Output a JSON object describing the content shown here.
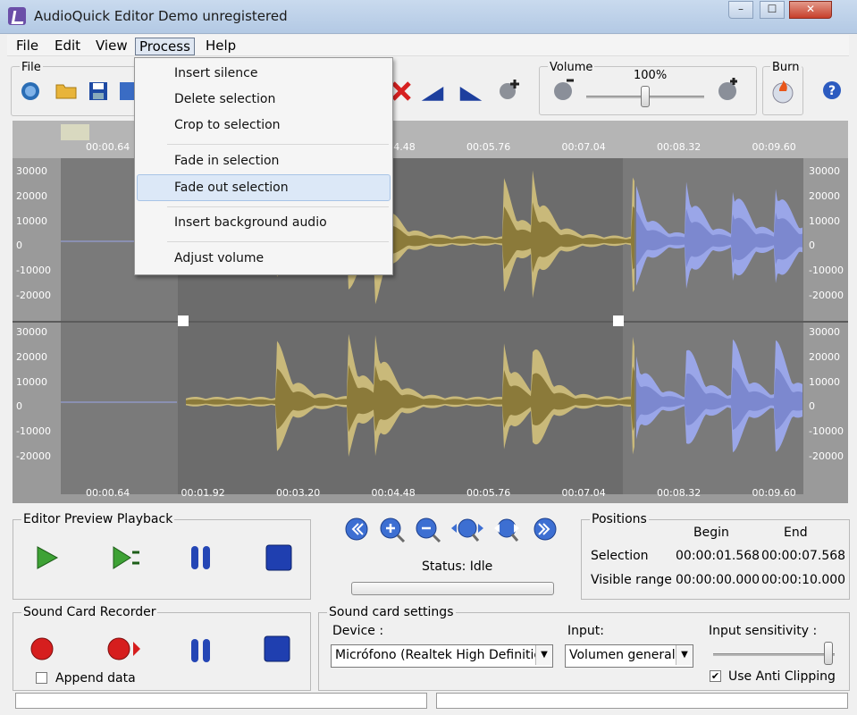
{
  "window": {
    "title": "AudioQuick Editor Demo unregistered",
    "min_glyph": "–",
    "max_glyph": "☐",
    "close_glyph": "✕"
  },
  "menubar": {
    "items": [
      "File",
      "Edit",
      "View",
      "Process",
      "Help"
    ]
  },
  "process_menu": {
    "group1": [
      "Insert silence",
      "Delete selection",
      "Crop to selection"
    ],
    "group2": [
      "Fade in selection",
      "Fade out selection"
    ],
    "group3": [
      "Insert background audio"
    ],
    "group4": [
      "Adjust volume"
    ],
    "highlighted": "Fade out selection"
  },
  "toolbar": {
    "file_label": "File",
    "volume_label": "Volume",
    "volume_value": "100%",
    "volume_level": 0.5,
    "burn_label": "Burn"
  },
  "waveform": {
    "amplitude_labels": [
      "30000",
      "20000",
      "10000",
      "0",
      "-10000",
      "-20000"
    ],
    "time_labels": [
      "00:00.64",
      "00:01.92",
      "00:03.20",
      "00:04.48",
      "00:05.76",
      "00:07.04",
      "00:08.32",
      "00:09.60"
    ],
    "colors": {
      "wave": "#8b7a3a",
      "wave_light": "#c9b97a",
      "wave_highlight": "#9aa6e8",
      "background": "#7a7a7a",
      "selection": "#6b6b6b"
    }
  },
  "preview": {
    "label": "Editor Preview Playback"
  },
  "nav": {
    "status": "Status: Idle"
  },
  "positions": {
    "label": "Positions",
    "begin": "Begin",
    "end": "End",
    "selection_label": "Selection",
    "selection_begin": "00:00:01.568",
    "selection_end": "00:00:07.568",
    "visible_label": "Visible range",
    "visible_begin": "00:00:00.000",
    "visible_end": "00:00:10.000"
  },
  "recorder": {
    "label": "Sound Card Recorder",
    "append": "Append data"
  },
  "soundcard": {
    "label": "Sound card settings",
    "device_label": "Device :",
    "device_value": "Micrófono (Realtek High Definition",
    "input_label": "Input:",
    "input_value": "Volumen general",
    "sensitivity_label": "Input sensitivity :",
    "anti_clipping": "Use Anti Clipping"
  }
}
